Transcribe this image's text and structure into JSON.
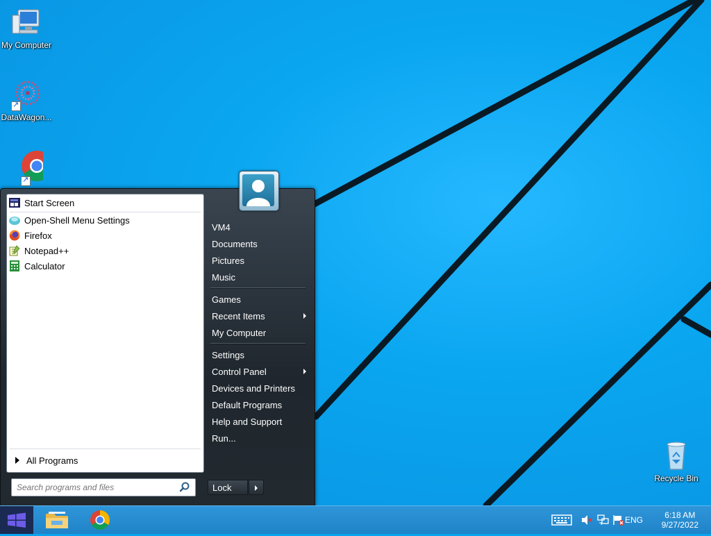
{
  "desktop": {
    "icons": [
      {
        "label": "My Computer"
      },
      {
        "label": "DataWagon..."
      },
      {
        "label": "Recycle Bin"
      }
    ]
  },
  "start_menu": {
    "programs": [
      {
        "label": "Start Screen",
        "icon": "start-screen-icon"
      },
      {
        "label": "Open-Shell Menu Settings",
        "icon": "open-shell-icon"
      },
      {
        "label": "Firefox",
        "icon": "firefox-icon"
      },
      {
        "label": "Notepad++",
        "icon": "notepad-icon"
      },
      {
        "label": "Calculator",
        "icon": "calculator-icon"
      }
    ],
    "all_programs": "All Programs",
    "search_placeholder": "Search programs and files",
    "right": {
      "user": "VM4",
      "documents": "Documents",
      "pictures": "Pictures",
      "music": "Music",
      "games": "Games",
      "recent_items": "Recent Items",
      "my_computer": "My Computer",
      "settings": "Settings",
      "control_panel": "Control Panel",
      "devices_printers": "Devices and Printers",
      "default_programs": "Default Programs",
      "help_support": "Help and Support",
      "run": "Run..."
    },
    "lock_label": "Lock"
  },
  "taskbar": {
    "lang": "ENG",
    "time": "6:18 AM",
    "date": "9/27/2022"
  }
}
